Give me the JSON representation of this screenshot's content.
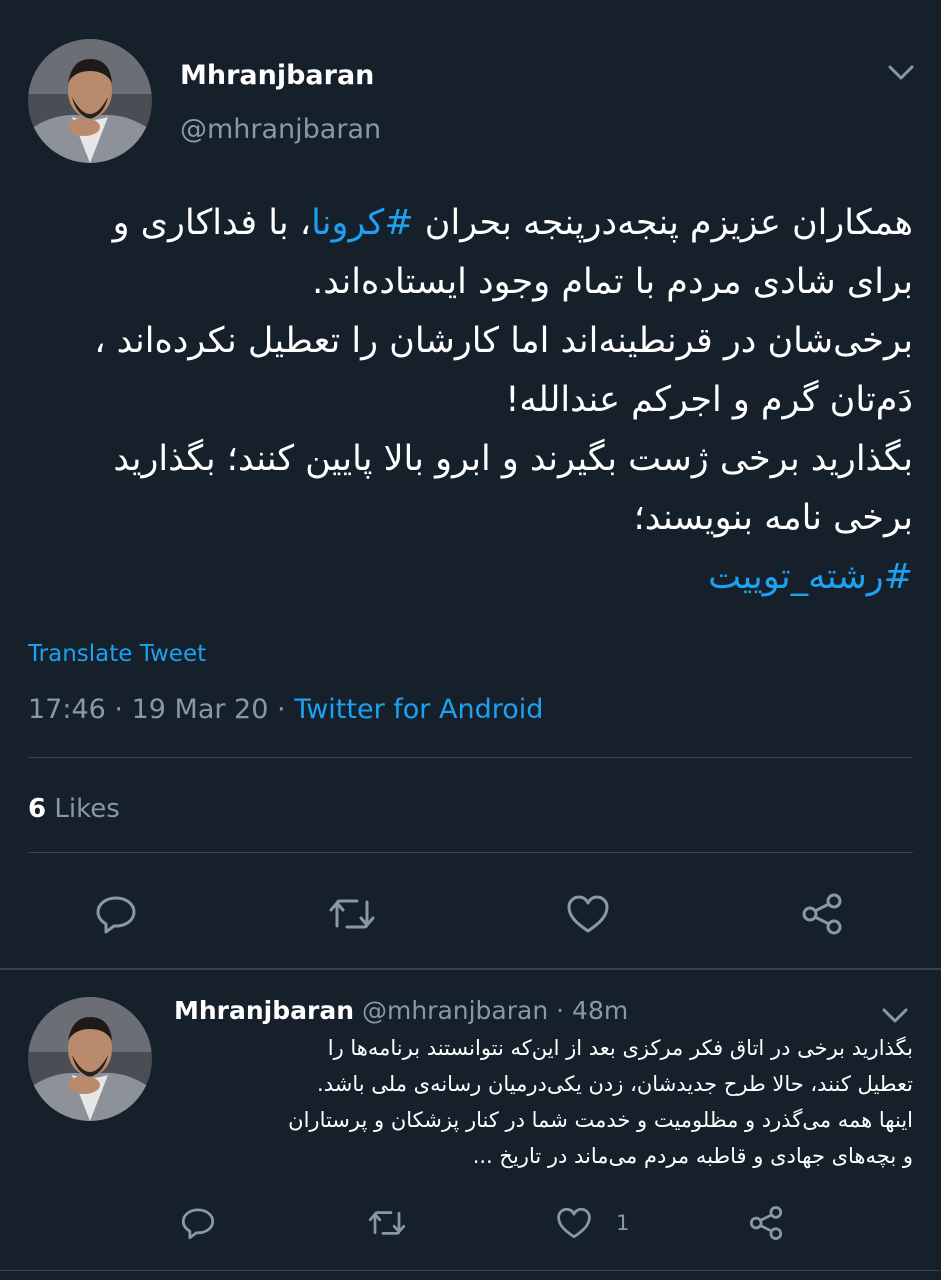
{
  "tweet": {
    "display_name": "Mhranjbaran",
    "handle": "@mhranjbaran",
    "body_lines": [
      {
        "before": "همکاران عزیزم پنجه‌درپنجه بحران ",
        "hashtag": "#کرونا",
        "after": "، با فداکاری و"
      },
      {
        "text": "برای شادی مردم با تمام وجود ایستاده‌اند."
      },
      {
        "text": "برخی‌شان در قرنطینه‌اند اما کارشان را تعطیل نکرده‌اند ،"
      },
      {
        "text": "دَم‌تان گرم و اجرکم عندالله!"
      },
      {
        "text": "بگذارید برخی ژست بگیرند و  ابرو بالا پایین کنند؛ بگذارید"
      },
      {
        "text": "برخی نامه بنویسند؛"
      }
    ],
    "thread_hashtag": "#رشته_توییت",
    "translate_label": "Translate Tweet",
    "time": "17:46",
    "date": "19 Mar 20",
    "separator": "·",
    "source": "Twitter for Android",
    "likes_count": "6",
    "likes_label": "Likes",
    "actions": [
      "reply-icon",
      "retweet-icon",
      "like-icon",
      "share-icon"
    ]
  },
  "reply": {
    "display_name": "Mhranjbaran",
    "handle": "@mhranjbaran",
    "separator": "·",
    "age": "48m",
    "body_lines": [
      "بگذارید برخی در اتاق فکر مرکزی بعد از این‌که نتوانستند برنامه‌ها را",
      "تعطیل کنند، حالا طرح جدیدشان، زدن یکی‌درمیان رسانه‌ی ملی باشد.",
      "اینها همه می‌گذرد و مظلومیت و خدمت شما در کنار پزشکان و پرستاران",
      "و بچه‌های جهادی و قاطبه مردم می‌ماند در تاریخ ..."
    ],
    "like_count": "1"
  },
  "colors": {
    "background": "#15202b",
    "accent": "#1da1f2",
    "secondary_text": "#8899a6",
    "divider": "#38444d"
  }
}
